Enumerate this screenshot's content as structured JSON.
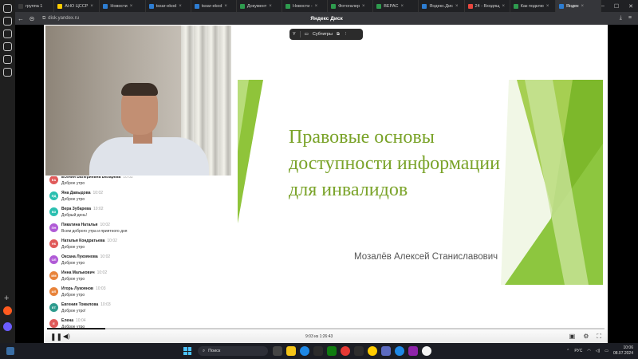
{
  "browser": {
    "tabs": [
      {
        "label": "группа 1",
        "color": "#3b3b3b",
        "active": false
      },
      {
        "label": "АНО ЦССР",
        "color": "#ffcc00",
        "active": false
      },
      {
        "label": "Новости",
        "color": "#2d7dd2",
        "active": false
      },
      {
        "label": "tssar-ekod",
        "color": "#2d7dd2",
        "active": false
      },
      {
        "label": "tssar-ekod",
        "color": "#2d7dd2",
        "active": false
      },
      {
        "label": "Документ",
        "color": "#2e9b4e",
        "active": false
      },
      {
        "label": "Новости - ",
        "color": "#2e9b4e",
        "active": false
      },
      {
        "label": "Фотогалер",
        "color": "#2e9b4e",
        "active": false
      },
      {
        "label": "ВЕРАС",
        "color": "#2e9b4e",
        "active": false
      },
      {
        "label": "Яндекс.Дис",
        "color": "#2d7dd2",
        "active": false
      },
      {
        "label": "24 - Входящ",
        "color": "#e8473f",
        "active": false
      },
      {
        "label": "Как подклю",
        "color": "#2e9b4e",
        "active": false
      },
      {
        "label": "Яндек",
        "color": "#2d7dd2",
        "active": true
      }
    ],
    "url": "disk.yandex.ru",
    "page_title": "Яндекс Диск"
  },
  "player": {
    "subtitles_label": "Субтитры",
    "time": "9:03 из 1:26:43",
    "progress_fraction": 0.104
  },
  "slide": {
    "title_lines": [
      "Правовые основы",
      "доступности информации",
      "для инвалидов"
    ],
    "author": "Мозалёв Алексей Станиславович",
    "accent_color": "#7aa329"
  },
  "chat": {
    "messages": [
      {
        "initials": "ЕА",
        "name": "Есения Валериевна Бехарева",
        "time": "10:02",
        "text": "Доброе утро",
        "color": "#e05a5a"
      },
      {
        "initials": "ЯД",
        "name": "Яна Давыдова",
        "time": "10:02",
        "text": "Доброе утро",
        "color": "#2bbfb0"
      },
      {
        "initials": "ВЗ",
        "name": "Вера Зубарева",
        "time": "10:02",
        "text": "Добрый день!",
        "color": "#2bbfb0"
      },
      {
        "initials": "ПН",
        "name": "Пикатина Наталья",
        "time": "10:02",
        "text": "Всем доброго утра и приятного дня",
        "color": "#b05ad6"
      },
      {
        "initials": "НК",
        "name": "Наталья Кондратьева",
        "time": "10:02",
        "text": "Доброе утро",
        "color": "#e05a5a"
      },
      {
        "initials": "ОЛ",
        "name": "Оксана Лукоянова",
        "time": "10:02",
        "text": "Доброе утро",
        "color": "#b05ad6"
      },
      {
        "initials": "ИМ",
        "name": "Инна Малькович",
        "time": "10:02",
        "text": "Доброе утро",
        "color": "#e8833a"
      },
      {
        "initials": "ИЛ",
        "name": "Игорь Лукоянов",
        "time": "10:03",
        "text": "Доброе утро",
        "color": "#e8833a"
      },
      {
        "initials": "ЕТ",
        "name": "Евгения Томилова",
        "time": "10:03",
        "text": "Доброе утро!",
        "color": "#2e9b8e"
      },
      {
        "initials": "Е",
        "name": "Елена",
        "time": "10:04",
        "text": "Доброе утро",
        "color": "#e05a5a"
      }
    ]
  },
  "taskbar": {
    "search_placeholder": "Поиск",
    "language": "РУС",
    "time": "10:06",
    "date": "08.07.2024"
  }
}
